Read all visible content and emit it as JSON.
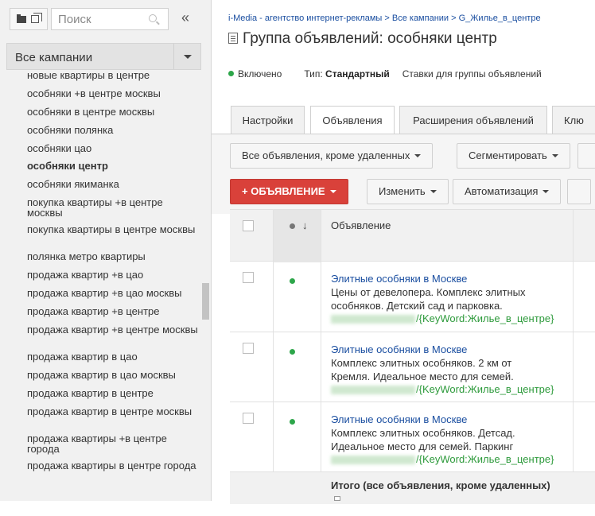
{
  "sidebar": {
    "search_placeholder": "Поиск",
    "collapse_glyph": "«",
    "campaign_selector": "Все кампании",
    "keywords": [
      {
        "label": "новые квартиры в центре",
        "bold": false
      },
      {
        "label": "особняки +в центре москвы",
        "bold": false
      },
      {
        "label": "особняки в центре москвы",
        "bold": false
      },
      {
        "label": "особняки полянка",
        "bold": false
      },
      {
        "label": "особняки цао",
        "bold": false
      },
      {
        "label": "особняки центр",
        "bold": true
      },
      {
        "label": "особняки якиманка",
        "bold": false
      },
      {
        "label": "покупка квартиры +в центре москвы",
        "bold": false
      },
      {
        "label": "покупка квартиры в центре москвы",
        "bold": false
      },
      {
        "label": "полянка метро квартиры",
        "bold": false
      },
      {
        "label": "продажа квартир +в цао",
        "bold": false
      },
      {
        "label": "продажа квартир +в цао москвы",
        "bold": false
      },
      {
        "label": "продажа квартир +в центре",
        "bold": false
      },
      {
        "label": "продажа квартир +в центре москвы",
        "bold": false
      },
      {
        "label": "продажа квартир в цао",
        "bold": false
      },
      {
        "label": "продажа квартир в цао москвы",
        "bold": false
      },
      {
        "label": "продажа квартир в центре",
        "bold": false
      },
      {
        "label": "продажа квартир в центре москвы",
        "bold": false
      },
      {
        "label": "продажа квартиры +в центре города",
        "bold": false
      },
      {
        "label": "продажа квартиры в центре города",
        "bold": false
      }
    ]
  },
  "header": {
    "breadcrumb": "i-Media - агентство интернет-рекламы > Все кампании > G_Жилье_в_центре",
    "title": "Группа объявлений: особняки центр",
    "status_label": "Включено",
    "type_prefix": "Тип:",
    "type_value": "Стандартный",
    "bids_text": "Ставки для группы объявлений"
  },
  "tabs": [
    {
      "label": "Настройки",
      "active": false
    },
    {
      "label": "Объявления",
      "active": true
    },
    {
      "label": "Расширения объявлений",
      "active": false
    },
    {
      "label": "Клю",
      "active": false
    }
  ],
  "toolbar": {
    "filter_label": "Все объявления, кроме удаленных",
    "segment_label": "Сегментировать",
    "new_ad_label": "+ ОБЪЯВЛЕНИЕ",
    "edit_label": "Изменить",
    "automate_label": "Автоматизация"
  },
  "table": {
    "column_header": "Объявление",
    "ads": [
      {
        "status": "enabled",
        "title": "Элитные особняки в Москве",
        "line1": "Цены от девелопера. Комплекс элитных",
        "line2": "особняков. Детский сад и парковка.",
        "url_suffix": "/{KeyWord:Жилье_в_центре}"
      },
      {
        "status": "enabled",
        "title": "Элитные особняки в Москве",
        "line1": "Комплекс элитных особняков. 2 км от",
        "line2": "Кремля. Идеальное место для семей.",
        "url_suffix": "/{KeyWord:Жилье_в_центре}"
      },
      {
        "status": "enabled",
        "title": "Элитные особняки в Москве",
        "line1": "Комплекс элитных особняков. Детсад.",
        "line2": "Идеальное место для семей. Паркинг",
        "url_suffix": "/{KeyWord:Жилье_в_центре}"
      }
    ],
    "total_label": "Итого (все объявления, кроме удаленных)"
  },
  "colors": {
    "accent_red": "#d9413a",
    "link_blue": "#1a4ea0",
    "url_green": "#2d9a3b",
    "status_green": "#2da64a"
  }
}
